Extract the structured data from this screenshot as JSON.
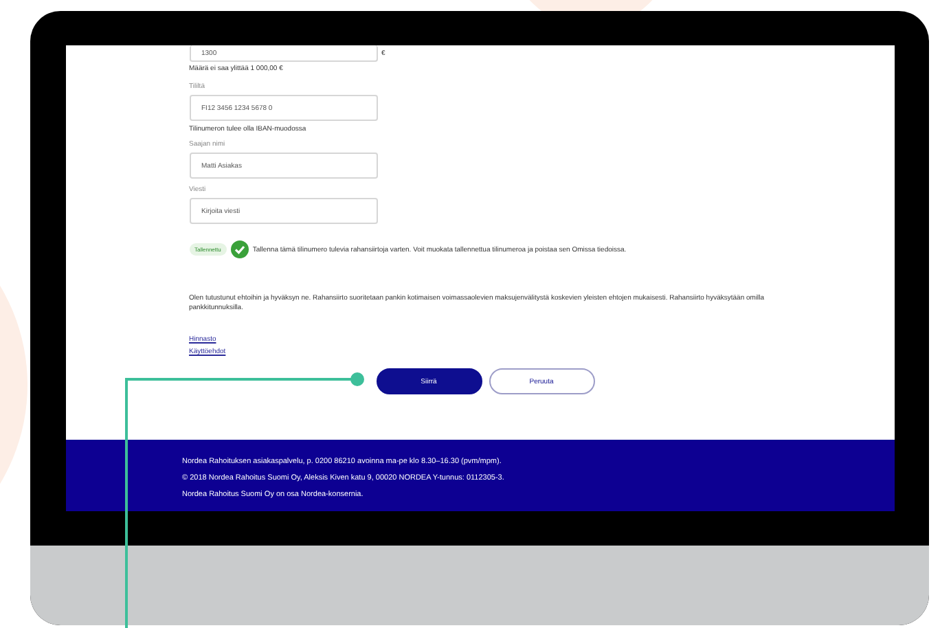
{
  "form": {
    "amount_field": {
      "value": "1300",
      "currency": "€",
      "hint": "Määrä ei saa ylittää 1 000,00 €"
    },
    "fields": [
      {
        "label": "Tililtä",
        "value": "FI12 3456 1234 5678 0",
        "hint": "Tilinumeron tulee olla IBAN-muodossa"
      },
      {
        "label": "Saajan nimi",
        "value": "Matti Asiakas"
      },
      {
        "label": "Viesti",
        "value": "Kirjoita viesti"
      }
    ],
    "save_account": {
      "badge": "Tallennettu",
      "checked": true,
      "text": "Tallenna tämä tilinumero tulevia rahansiirtoja varten. Voit muokata tallennettua tilinumeroa ja poistaa sen Omissa tiedoissa."
    },
    "terms": "Olen tutustunut ehtoihin ja hyväksyn ne. Rahansiirto suoritetaan pankin kotimaisen voimassaolevien maksujenvälitystä koskevien yleisten ehtojen mukaisesti. Rahansiirto hyväksytään omilla pankkitunnuksilla.",
    "links": [
      "Hinnasto",
      "Käyttöehdot"
    ],
    "buttons": [
      {
        "label": "Siirrä",
        "kind": "primary"
      },
      {
        "label": "Peruuta",
        "kind": "secondary"
      }
    ]
  },
  "footer": [
    "Nordea Rahoituksen asiakaspalvelu, p. 0200 86210 avoinna ma-pe klo 8.30–16.30 (pvm/mpm).",
    "© 2018 Nordea Rahoitus Suomi Oy, Aleksis Kiven katu 9, 00020 NORDEA Y-tunnus: 0112305-3.",
    "Nordea Rahoitus Suomi Oy on osa Nordea-konsernia."
  ]
}
